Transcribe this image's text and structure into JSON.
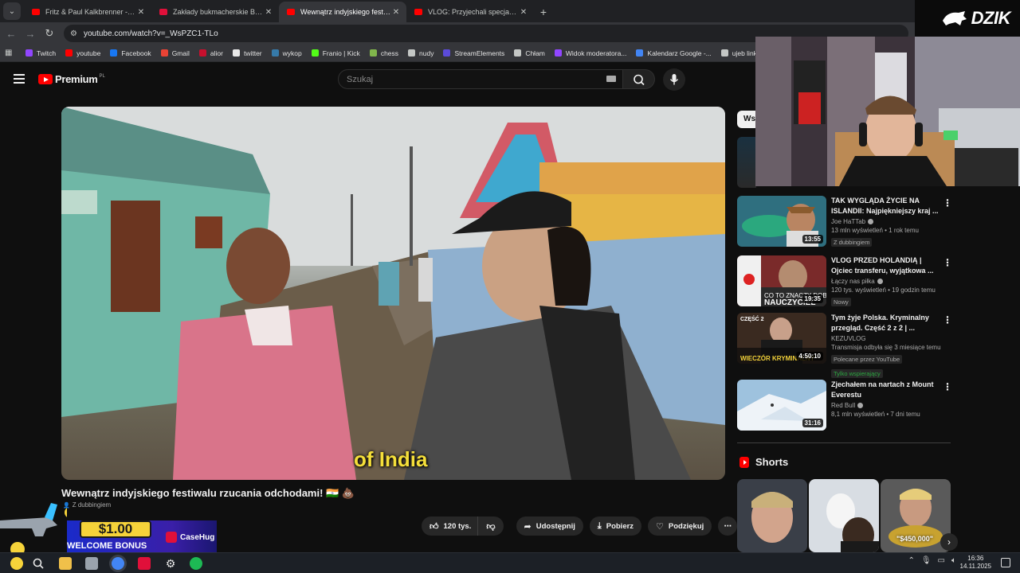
{
  "browser": {
    "tabs": [
      {
        "title": "Fritz & Paul Kalkbrenner - Sky a",
        "fav_color": "#ff0000",
        "active": false
      },
      {
        "title": "Zakłady bukmacherskie Betclic",
        "fav_color": "#e0103a",
        "active": false
      },
      {
        "title": "Wewnątrz indyjskiego festiwalu",
        "fav_color": "#ff0000",
        "active": true
      },
      {
        "title": "VLOG: Przyjechali specjalnie do",
        "fav_color": "#ff0000",
        "active": false
      }
    ],
    "url": "youtube.com/watch?v=_WsPZC1-TLo",
    "bookmarks": [
      {
        "label": "Twitch",
        "color": "#9146ff"
      },
      {
        "label": "youtube",
        "color": "#ff0000"
      },
      {
        "label": "Facebook",
        "color": "#1877f2"
      },
      {
        "label": "Gmail",
        "color": "#ea4335"
      },
      {
        "label": "alior",
        "color": "#c8102e"
      },
      {
        "label": "twitter",
        "color": "#e8e8e8"
      },
      {
        "label": "wykop",
        "color": "#367aa9"
      },
      {
        "label": "Franio | Kick",
        "color": "#53fc18"
      },
      {
        "label": "chess",
        "color": "#81b64c"
      },
      {
        "label": "nudy",
        "color": "#c4c7c5"
      },
      {
        "label": "StreamElements",
        "color": "#5b4bd8"
      },
      {
        "label": "Chłam",
        "color": "#c4c7c5"
      },
      {
        "label": "Widok moderatora...",
        "color": "#9146ff"
      },
      {
        "label": "Kalendarz Google -...",
        "color": "#4285f4"
      },
      {
        "label": "ujeb link",
        "color": "#c4c7c5"
      }
    ]
  },
  "youtube": {
    "logo_text": "Premium",
    "logo_country": "PL",
    "search_placeholder": "Szukaj",
    "subtitle": "of India",
    "video_title": "Wewnątrz indyjskiego festiwalu rzucania odchodami! 🇮🇳 💩",
    "dub_label": "Z dubbingiem",
    "actions": {
      "likes": "120 tys.",
      "share": "Udostępnij",
      "download": "Pobierz",
      "thanks": "Podziękuj"
    },
    "filter_chip": "Wsz",
    "recommendations": [
      {
        "title": "TAK WYGLĄDA ŻYCIE NA ISLANDII: Najpiękniejszy kraj ...",
        "channel": "Joe HaTTab",
        "stats": "13 mln wyświetleń • 1 rok temu",
        "duration": "13:55",
        "badges": [
          "Z dubbingiem"
        ]
      },
      {
        "title": "VLOG PRZED HOLANDIĄ | Ojciec transferu, wyjątkowa ...",
        "channel": "Łączy nas piłka",
        "stats": "120 tys. wyświetleń • 19 godzin temu",
        "duration": "19:35",
        "badges": [
          "Nowy"
        ]
      },
      {
        "title": "Tym żyje Polska. Kryminalny przegląd. Część 2 z 2 | ...",
        "channel": "KEZUVLOG",
        "stats": "Transmisja odbyła się 3 miesiące temu",
        "duration": "4:50:10",
        "badges": [
          "Polecane przez YouTube",
          "Tylko wspierający"
        ]
      },
      {
        "title": "Zjechałem na nartach z Mount Everestu",
        "channel": "Red Bull",
        "stats": "8,1 mln wyświetleń • 7 dni temu",
        "duration": "31:16",
        "badges": []
      }
    ],
    "shorts_title": "Shorts",
    "shorts_overlay": "\"$450,000\""
  },
  "overlay": {
    "streamer_brand": "DZIK",
    "promo_amount": "$1.00",
    "promo_text": "WELCOME BONUS",
    "promo_brand": "CaseHug"
  },
  "taskbar": {
    "time": "16:36",
    "date": "14.11.2025"
  },
  "colors": {
    "yt_red": "#ff0000",
    "subtitle_yellow": "#f5df3a",
    "promo_yellow": "#f6d33a"
  }
}
